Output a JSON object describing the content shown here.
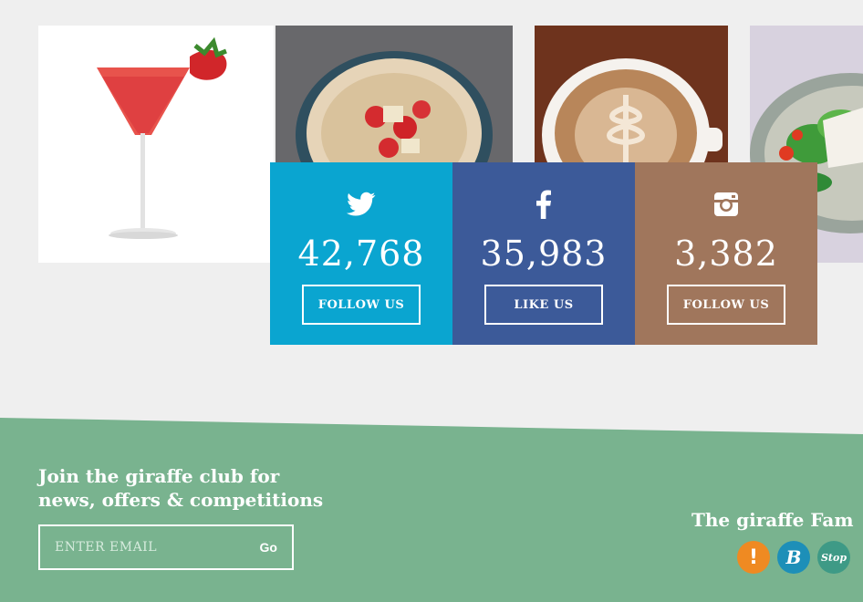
{
  "social": [
    {
      "network": "twitter",
      "icon": "twitter-bird-icon",
      "count": "42,768",
      "button": "FOLLOW US",
      "color": "#0aa5d0"
    },
    {
      "network": "facebook",
      "icon": "facebook-f-icon",
      "count": "35,983",
      "button": "LIKE US",
      "color": "#3c5a99"
    },
    {
      "network": "instagram",
      "icon": "instagram-camera-icon",
      "count": "3,382",
      "button": "FOLLOW US",
      "color": "#a0765c"
    }
  ],
  "club": {
    "heading_line1": "Join the giraffe club for",
    "heading_line2": "news, offers & competitions",
    "email_placeholder": "ENTER EMAIL",
    "submit_label": "Go"
  },
  "family": {
    "heading": "The giraffe Fam",
    "brands": [
      {
        "icon": "exclamation-brand-icon",
        "glyph": "!",
        "color": "#ef8a22"
      },
      {
        "icon": "b-brand-icon",
        "glyph": "B",
        "color": "#1d8fb8"
      },
      {
        "icon": "stop-brand-icon",
        "glyph": "Stop",
        "color": "#3e9a86"
      }
    ]
  },
  "colors": {
    "page_background": "#efefef",
    "footer_green": "#79b38f"
  }
}
